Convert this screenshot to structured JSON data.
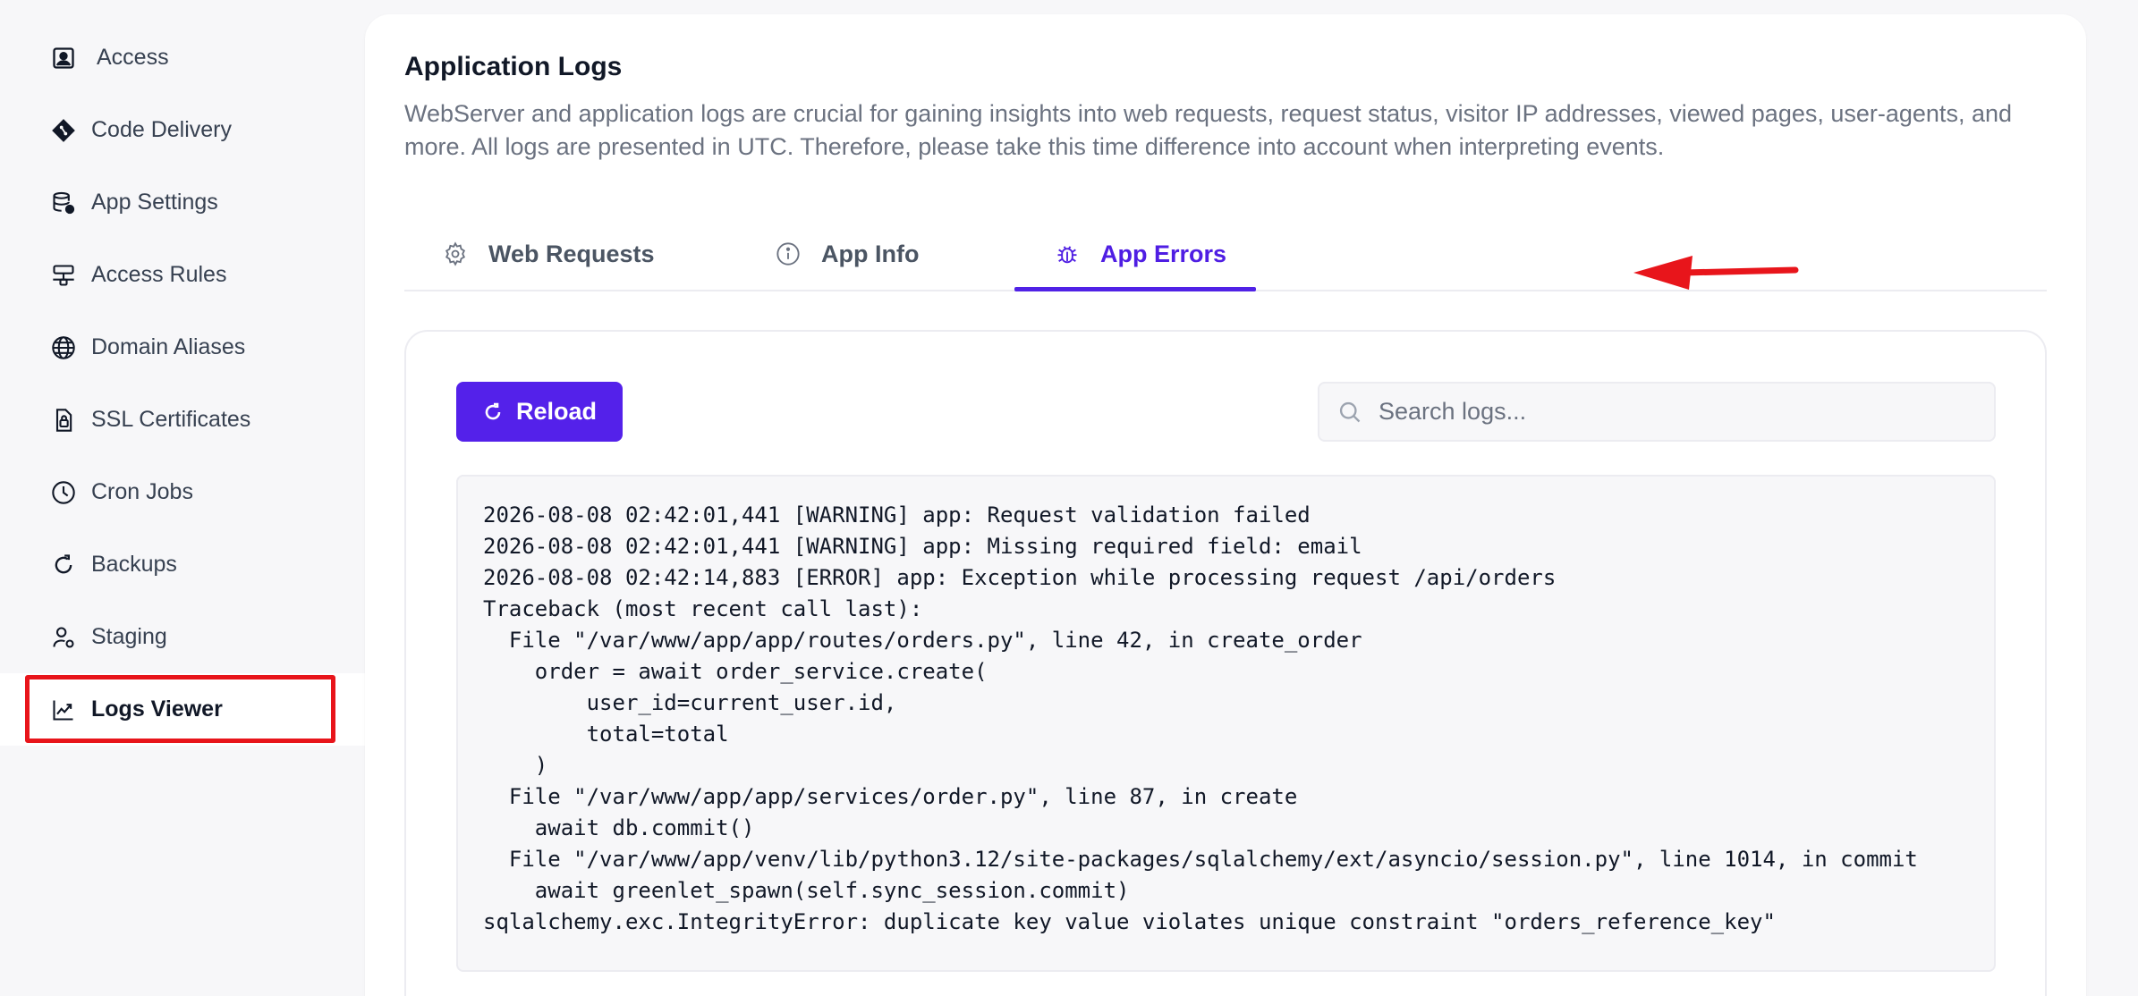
{
  "sidebar": {
    "items": [
      {
        "label": "Access",
        "icon": "user-square-icon"
      },
      {
        "label": "Code Delivery",
        "icon": "git-diamond-icon"
      },
      {
        "label": "App Settings",
        "icon": "database-gear-icon"
      },
      {
        "label": "Access Rules",
        "icon": "network-icon"
      },
      {
        "label": "Domain Aliases",
        "icon": "globe-icon"
      },
      {
        "label": "SSL Certificates",
        "icon": "file-lock-icon"
      },
      {
        "label": "Cron Jobs",
        "icon": "clock-icon"
      },
      {
        "label": "Backups",
        "icon": "refresh-icon"
      },
      {
        "label": "Staging",
        "icon": "user-gear-icon"
      },
      {
        "label": "Logs Viewer",
        "icon": "chart-line-icon",
        "active": true
      }
    ]
  },
  "header": {
    "title": "Application Logs",
    "description": "WebServer and application logs are crucial for gaining insights into web requests, request status, visitor IP addresses, viewed pages, user-agents, and more. All logs are presented in UTC. Therefore, please take this time difference into account when interpreting events."
  },
  "tabs": [
    {
      "label": "Web Requests",
      "icon": "gear-icon"
    },
    {
      "label": "App Info",
      "icon": "info-icon"
    },
    {
      "label": "App Errors",
      "icon": "bug-icon",
      "active": true
    }
  ],
  "toolbar": {
    "reload_label": "Reload",
    "search_placeholder": "Search logs..."
  },
  "logs": [
    "2026-08-08 02:42:01,441 [WARNING] app: Request validation failed",
    "2026-08-08 02:42:01,441 [WARNING] app: Missing required field: email",
    "2026-08-08 02:42:14,883 [ERROR] app: Exception while processing request /api/orders",
    "Traceback (most recent call last):",
    "  File \"/var/www/app/app/routes/orders.py\", line 42, in create_order",
    "    order = await order_service.create(",
    "        user_id=current_user.id,",
    "        total=total",
    "    )",
    "  File \"/var/www/app/app/services/order.py\", line 87, in create",
    "    await db.commit()",
    "  File \"/var/www/app/venv/lib/python3.12/site-packages/sqlalchemy/ext/asyncio/session.py\", line 1014, in commit",
    "    await greenlet_spawn(self.sync_session.commit)",
    "sqlalchemy.exc.IntegrityError: duplicate key value violates unique constraint \"orders_reference_key\""
  ],
  "colors": {
    "accent": "#5421ea",
    "annotation": "#e8151b"
  }
}
